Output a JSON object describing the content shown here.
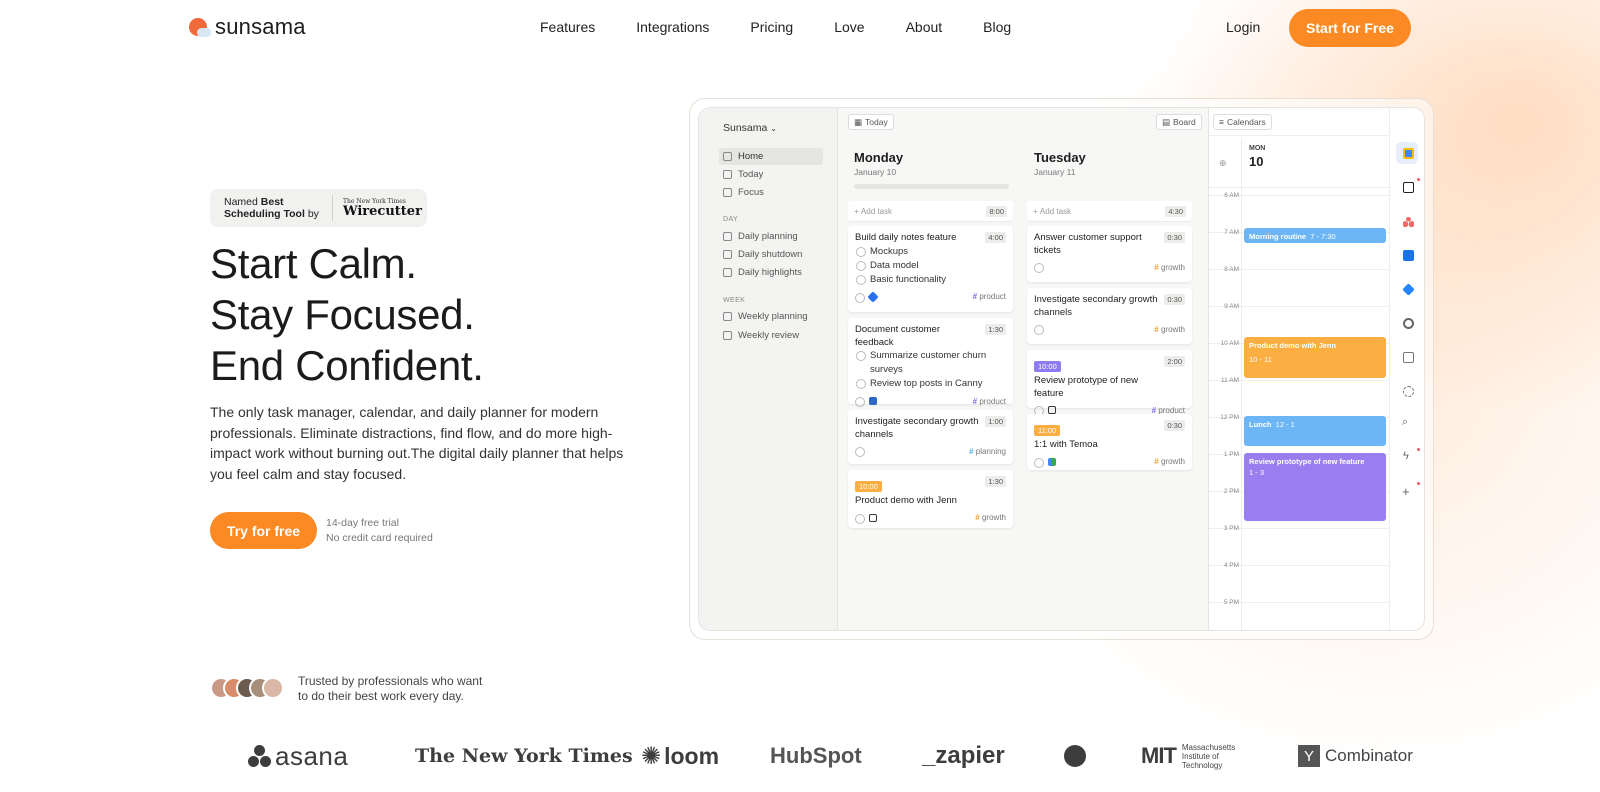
{
  "brand": {
    "name": "sunsama",
    "accent": "#fb8a24"
  },
  "nav": {
    "links": [
      "Features",
      "Integrations",
      "Pricing",
      "Love",
      "About",
      "Blog"
    ],
    "login": "Login",
    "cta": "Start for Free"
  },
  "badge": {
    "named": "Named",
    "best": "Best",
    "line2": "Scheduling Tool",
    "by": "by",
    "nyt": "The New York Times",
    "wirecutter": "Wirecutter"
  },
  "hero": {
    "lines": [
      "Start Calm.",
      "Stay Focused.",
      "End Confident."
    ],
    "description": "The only task manager, calendar, and daily planner for modern professionals. Eliminate distractions, find flow, and do more high-impact work without burning out.The digital daily planner that helps you feel calm and stay focused.",
    "cta": "Try for free",
    "trial_line1": "14-day free trial",
    "trial_line2": "No credit card required"
  },
  "app": {
    "workspace": "Sunsama",
    "sidebar": {
      "top": [
        "Home",
        "Today",
        "Focus"
      ],
      "day_header": "DAY",
      "day": [
        "Daily planning",
        "Daily shutdown",
        "Daily highlights"
      ],
      "week_header": "WEEK",
      "week": [
        "Weekly planning",
        "Weekly review"
      ]
    },
    "toolbar": {
      "today": "Today",
      "board": "Board",
      "calendars": "Calendars"
    },
    "monday": {
      "title": "Monday",
      "date": "January 10",
      "add_task": "Add task",
      "add_dur": "8:00",
      "cards": [
        {
          "title": "Build daily notes feature",
          "dur": "4:00",
          "subs": [
            "Mockups",
            "Data model",
            "Basic functionality"
          ],
          "tag": "product"
        },
        {
          "title": "Document customer feedback",
          "dur": "1:30",
          "subs": [
            "Summarize customer churn surveys",
            "Review top posts in Canny"
          ],
          "tag": "product"
        },
        {
          "title": "Investigate secondary growth channels",
          "dur": "1:00",
          "tag": "planning"
        },
        {
          "time": "10:00",
          "title": "Product demo with Jenn",
          "dur": "1:30",
          "tag": "growth"
        }
      ]
    },
    "tuesday": {
      "title": "Tuesday",
      "date": "January 11",
      "add_task": "Add task",
      "add_dur": "4:30",
      "cards": [
        {
          "title": "Answer customer support tickets",
          "dur": "0:30",
          "tag": "growth"
        },
        {
          "title": "Investigate secondary growth channels",
          "dur": "0:30",
          "tag": "growth"
        },
        {
          "time": "10:00",
          "title": "Review prototype of new feature",
          "dur": "2:00",
          "tag": "product"
        },
        {
          "time": "11:00",
          "title": "1:1 with Temoa",
          "dur": "0:30",
          "tag": "growth"
        }
      ]
    },
    "calendar": {
      "day_abbr": "MON",
      "day_num": "10",
      "hours": [
        "6 AM",
        "7 AM",
        "8 AM",
        "9 AM",
        "10 AM",
        "11 AM",
        "12 PM",
        "1 PM",
        "2 PM",
        "3 PM",
        "4 PM",
        "5 PM"
      ],
      "events": [
        {
          "title": "Morning routine",
          "time": "7 - 7:30",
          "color": "#6cb6f5"
        },
        {
          "title": "Product demo with Jenn",
          "time": "10 - 11",
          "color": "#fbae42"
        },
        {
          "title": "Lunch",
          "time": "12 - 1",
          "color": "#6cb6f5"
        },
        {
          "title": "Review prototype of new feature",
          "time": "1 - 3",
          "color": "#9a7ef0"
        }
      ]
    },
    "rail_icons": [
      "google-calendar-icon",
      "notion-icon",
      "asana-icon",
      "trello-icon",
      "jira-icon",
      "target-icon",
      "archive-icon",
      "refresh-icon",
      "search-icon",
      "bolt-icon",
      "plus-icon"
    ]
  },
  "trust": {
    "line1": "Trusted by professionals who want",
    "line2": "to do their best work every day."
  },
  "logos": {
    "asana": "asana",
    "nyt": "The New York Times",
    "loom": "loom",
    "hubspot": "HubSpot",
    "zapier": "_zapier",
    "mit_line1": "Massachusetts",
    "mit_line2": "Institute of",
    "mit_line3": "Technology",
    "yc_letter": "Y",
    "yc": "Combinator"
  }
}
